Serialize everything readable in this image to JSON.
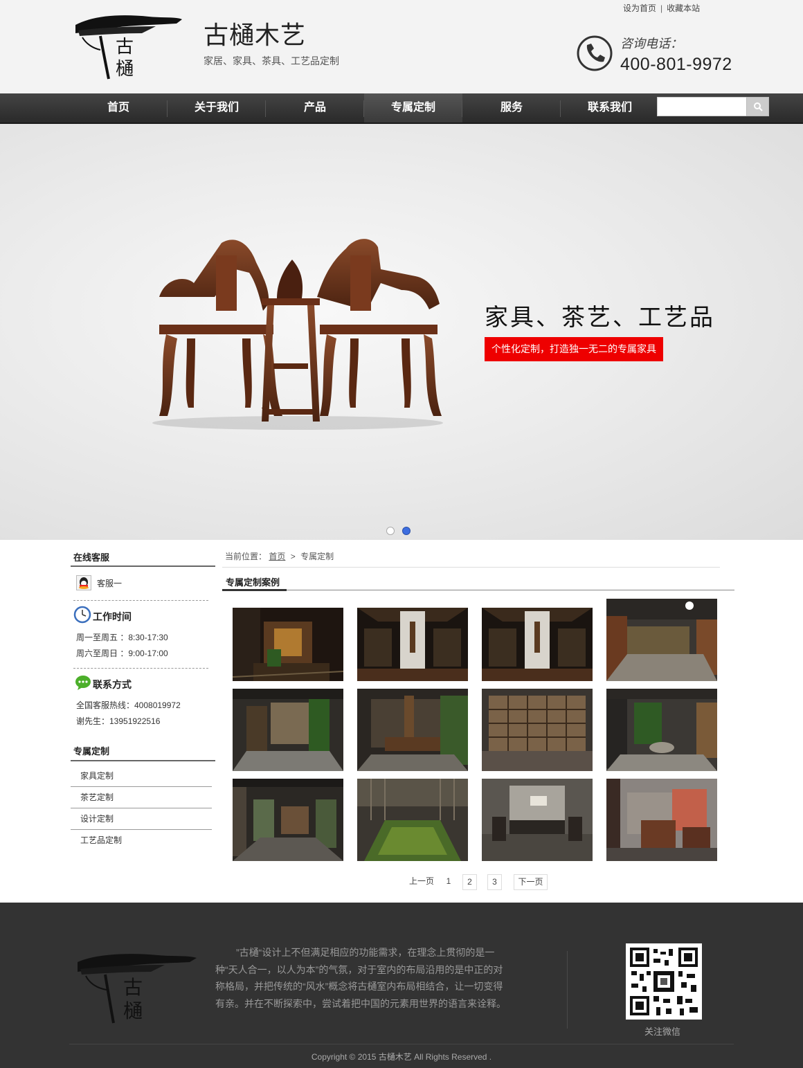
{
  "header": {
    "site_title": "古樋木艺",
    "site_subtitle": "家居、家具、茶具、工艺品定制",
    "top_links": [
      "设为首页",
      "收藏本站"
    ],
    "top_sep": "|",
    "phone_label": "咨询电话：",
    "phone_number": "400-801-9972",
    "logo_char1": "古",
    "logo_char2": "樋"
  },
  "nav": {
    "items": [
      "首页",
      "关于我们",
      "产品",
      "专属定制",
      "服务",
      "联系我们"
    ],
    "active": "专属定制",
    "search_placeholder": ""
  },
  "banner": {
    "headline": "家具、茶艺、工艺品",
    "cta": "个性化定制，打造独一无二的专属家具",
    "slide_count": 2,
    "active_slide": 2
  },
  "sidebar": {
    "online_title": "在线客服",
    "service_agent": "客服一",
    "hours_title": "工作时间",
    "hours": [
      "周一至周五 ：8:30-17:30",
      "周六至周日 ：9:00-17:00"
    ],
    "contact_title": "联系方式",
    "contact": [
      "全国客服热线：4008019972",
      "谢先生：13951922516"
    ],
    "category_title": "专属定制",
    "categories": [
      "家具定制",
      "茶艺定制",
      "设计定制",
      "工艺品定制"
    ]
  },
  "main": {
    "breadcrumb_prefix": "当前位置：",
    "breadcrumb_home": "首页",
    "breadcrumb_sep": ">",
    "breadcrumb_current": "专属定制",
    "section_title": "专属定制案例",
    "pagination": {
      "prev": "上一页",
      "pages": [
        "1",
        "2",
        "3"
      ],
      "next": "下一页",
      "current_page": "1"
    }
  },
  "footer": {
    "about_text": "”古樋“设计上不但满足相应的功能需求，在理念上贯彻的是一种“天人合一，以人为本”的气氛，对于室内的布局沿用的是中正的对称格局，并把传统的“风水”概念将古樋室内布局相结合，让一切变得有亲。并在不断探索中，尝试着把中国的元素用世界的语言来诠释。",
    "qr_label": "关注微信",
    "copyright": "Copyright © 2015  古樋木艺  All Rights Reserved ."
  },
  "colors": {
    "nav_bg": "#333333",
    "cta_red": "#ee0000",
    "footer_bg": "#333333",
    "active_dot": "#3d6ee0"
  }
}
